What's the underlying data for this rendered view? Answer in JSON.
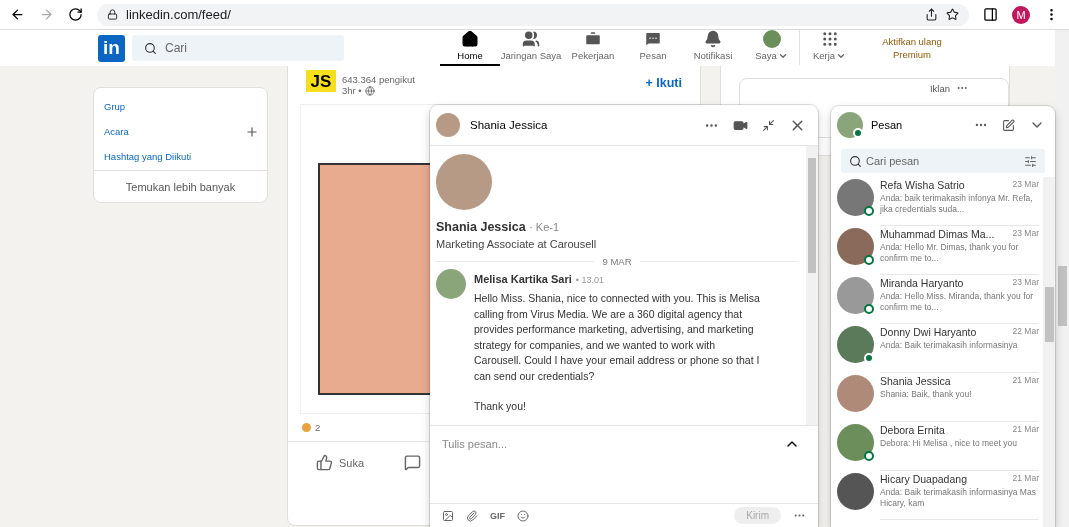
{
  "browser": {
    "url": "linkedin.com/feed/",
    "profile_initial": "M"
  },
  "nav": {
    "search_placeholder": "Cari",
    "items": [
      {
        "label": "Home",
        "dropdown": false,
        "selected": true
      },
      {
        "label": "Jaringan Saya",
        "dropdown": false,
        "selected": false
      },
      {
        "label": "Pekerjaan",
        "dropdown": false,
        "selected": false
      },
      {
        "label": "Pesan",
        "dropdown": false,
        "selected": false
      },
      {
        "label": "Notifikasi",
        "dropdown": false,
        "selected": false
      },
      {
        "label": "Saya",
        "dropdown": true,
        "selected": false
      },
      {
        "label": "Kerja",
        "dropdown": true,
        "selected": false
      }
    ],
    "logo": "in",
    "premium": "Aktifkan ulang Premium"
  },
  "sidebar": {
    "links": [
      {
        "label": "Grup",
        "add": false
      },
      {
        "label": "Acara",
        "add": true
      },
      {
        "label": "Hashtag yang Diikuti",
        "add": false
      }
    ],
    "more": "Temukan lebih banyak"
  },
  "post": {
    "logo": "JS",
    "followers": "643.364 pengikut",
    "time": "3hr •",
    "follow": "+ Ikuti",
    "reactions": "2",
    "actions": [
      {
        "kind": "like",
        "label": "Suka"
      },
      {
        "kind": "comment"
      }
    ]
  },
  "ad": {
    "label": "Iklan"
  },
  "chat": {
    "name": "Shania Jessica",
    "profile": {
      "name": "Shania Jessica",
      "degree": "· Ke-1",
      "headline": "Marketing Associate at Carousell"
    },
    "date": "9 MAR",
    "messages": [
      {
        "sender": "Melisa Kartika Sari",
        "time": "• 13.01",
        "paragraphs": [
          "Hello Miss. Shania, nice to connected with you. This is Melisa calling from Virus Media. We are a 360 digital agency that provides performance marketing, advertising, and marketing strategy for companies, and we wanted to work with Carousell. Could I have your email address or phone so that I can send our credentials?",
          "Thank you!"
        ]
      }
    ],
    "composer": {
      "placeholder": "Tulis pesan...",
      "gif": "GIF",
      "send": "Kirim",
      "send_disabled": true
    }
  },
  "messaging": {
    "title": "Pesan",
    "search_placeholder": "Cari pesan",
    "conversations": [
      {
        "name": "Refa Wisha Satrio",
        "date": "23 Mar",
        "preview": "Anda: baik terimakasih infonya Mr. Refa, jika credentials suda...",
        "kind": "mobile"
      },
      {
        "name": "Muhammad Dimas Ma...",
        "date": "23 Mar",
        "preview": "Anda: Hello Mr. Dimas, thank you for confirm me to...",
        "kind": "mobile"
      },
      {
        "name": "Miranda Haryanto",
        "date": "23 Mar",
        "preview": "Anda: Hello Miss. Miranda, thank you for confirm me to...",
        "kind": "mobile"
      },
      {
        "name": "Donny Dwi Haryanto",
        "date": "22 Mar",
        "preview": "Anda: Baik terimakasih informasinya",
        "kind": "online"
      },
      {
        "name": "Shania Jessica",
        "date": "21 Mar",
        "preview": "Shania: Baik, thank you!",
        "kind": "offline"
      },
      {
        "name": "Debora Ernita",
        "date": "21 Mar",
        "preview": "Debora: Hi Melisa , nice to meet you",
        "kind": "mobile"
      },
      {
        "name": "Hicary Duapadang",
        "date": "21 Mar",
        "preview": "Anda: Baik terimakasih informasinya Mas Hicary, kam",
        "kind": "offline"
      }
    ]
  }
}
